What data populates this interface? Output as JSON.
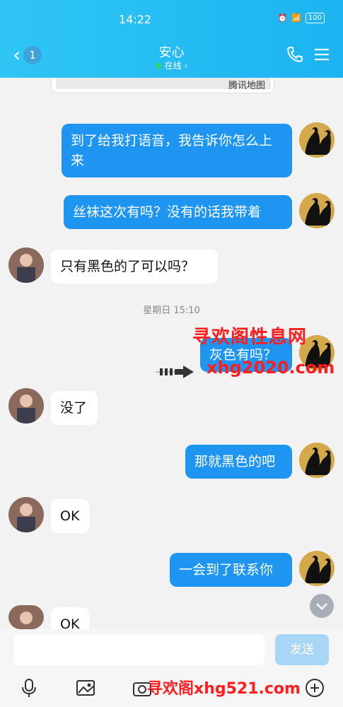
{
  "status": {
    "time": "14:22",
    "battery": "100"
  },
  "header": {
    "back_count": "1",
    "title": "安心",
    "presence": "在线 ›"
  },
  "map": {
    "label": "腾讯地图"
  },
  "messages": [
    {
      "from": "me",
      "text": "到了给我打语音，我告诉你怎么上来"
    },
    {
      "from": "me",
      "text": "丝袜这次有吗？没有的话我带着"
    },
    {
      "from": "them",
      "text": "只有黑色的了可以吗？"
    },
    {
      "from": "me",
      "text": "灰色有吗？"
    },
    {
      "from": "them",
      "text": "没了"
    },
    {
      "from": "me",
      "text": "那就黑色的吧"
    },
    {
      "from": "them",
      "text": "OK"
    },
    {
      "from": "me",
      "text": "一会到了联系你"
    },
    {
      "from": "them",
      "text": "OK"
    }
  ],
  "timestamp": "星期日 15:10",
  "input": {
    "send_label": "发送"
  },
  "watermark": {
    "line1": "寻欢阁性息网",
    "line2": "xhg2020.com",
    "line3": "寻欢阁xhg521.com"
  },
  "colors": {
    "header": "#1cb3f2",
    "my_bubble": "#1e95f0",
    "their_bubble": "#ffffff",
    "send_disabled": "#a8d6f7"
  },
  "icons": [
    "back-chevron-icon",
    "phone-icon",
    "menu-icon",
    "microphone-icon",
    "image-icon",
    "camera-icon",
    "add-icon",
    "chevron-down-icon"
  ]
}
